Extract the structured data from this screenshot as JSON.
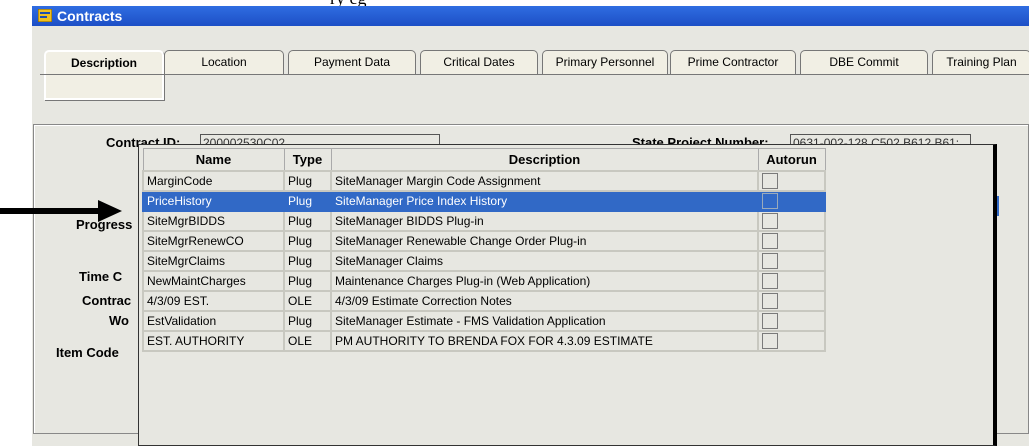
{
  "top_fragment": "ry eg",
  "window": {
    "title": "Contracts"
  },
  "tabs": [
    {
      "label": "Description",
      "active": true
    },
    {
      "label": "Location"
    },
    {
      "label": "Payment Data"
    },
    {
      "label": "Critical Dates"
    },
    {
      "label": "Primary Personnel"
    },
    {
      "label": "Prime Contractor"
    },
    {
      "label": "DBE Commit"
    },
    {
      "label": "Training Plan"
    }
  ],
  "form": {
    "contract_id_label": "Contract ID:",
    "contract_id_value": "200002530C02",
    "state_project_label": "State Project Number:",
    "state_project_value": "0631-002-128 C502 B612 B61:",
    "progress_label": "Progress",
    "time_label": "Time C",
    "contract_label": "Contrac",
    "wo_label": "Wo",
    "item_code_label": "Item Code"
  },
  "popup": {
    "columns": [
      "Name",
      "Type",
      "Description",
      "Autorun"
    ],
    "rows": [
      {
        "name": "MarginCode",
        "type": "Plug",
        "description": "SiteManager Margin Code Assignment",
        "selected": false
      },
      {
        "name": "PriceHistory",
        "type": "Plug",
        "description": "SiteManager Price Index History",
        "selected": true
      },
      {
        "name": "SiteMgrBIDDS",
        "type": "Plug",
        "description": "SiteManager BIDDS Plug-in",
        "selected": false
      },
      {
        "name": "SiteMgrRenewCO",
        "type": "Plug",
        "description": "SiteManager Renewable Change Order Plug-in",
        "selected": false
      },
      {
        "name": "SiteMgrClaims",
        "type": "Plug",
        "description": "SiteManager Claims",
        "selected": false
      },
      {
        "name": "NewMaintCharges",
        "type": "Plug",
        "description": "Maintenance Charges Plug-in (Web Application)",
        "selected": false
      },
      {
        "name": "4/3/09 EST.",
        "type": "OLE",
        "description": "4/3/09 Estimate Correction Notes",
        "selected": false
      },
      {
        "name": "EstValidation",
        "type": "Plug",
        "description": "SiteManager Estimate - FMS Validation Application",
        "selected": false
      },
      {
        "name": "EST. AUTHORITY",
        "type": "OLE",
        "description": "PM AUTHORITY TO BRENDA FOX FOR 4.3.09 ESTIMATE",
        "selected": false
      }
    ]
  },
  "colors": {
    "titlebar": "#2f6de1",
    "selection": "#3169c6",
    "background": "#e7e7e1"
  },
  "icons": {
    "app": "contracts-window-icon",
    "pointer": "black-arrow-pointer"
  }
}
